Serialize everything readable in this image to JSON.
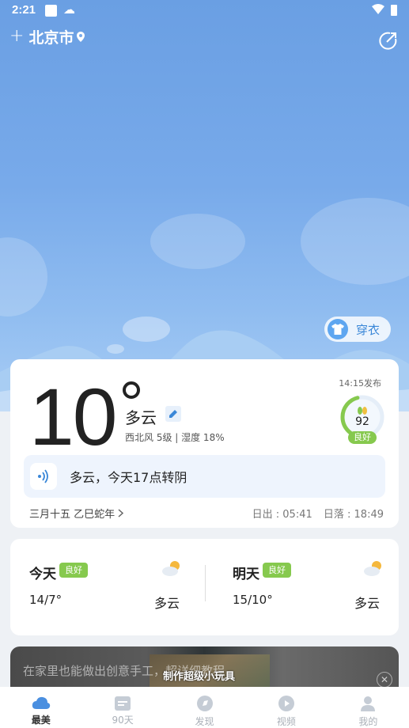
{
  "status_bar": {
    "time": "2:21"
  },
  "header": {
    "city": "北京市"
  },
  "clothing": {
    "label": "穿衣"
  },
  "current": {
    "temperature": "10",
    "condition": "多云",
    "wind_humidity": "西北风 5级 | 湿度 18%",
    "publish_time": "14:15发布",
    "aqi_value": "92",
    "aqi_label": "良好",
    "aqi_fraction": 0.46,
    "forecast_summary": "多云，今天17点转阴",
    "lunar_date": "三月十五 乙巳蛇年",
    "sunrise": "日出 : 05:41",
    "sunset": "日落 : 18:49"
  },
  "daily": [
    {
      "day": "今天",
      "badge": "良好",
      "temp": "14/7°",
      "condition": "多云",
      "icon": "partly-cloudy-icon"
    },
    {
      "day": "明天",
      "badge": "良好",
      "temp": "15/10°",
      "condition": "多云",
      "icon": "partly-cloudy-icon"
    }
  ],
  "ad": {
    "text": "在家里也能做出创意手工，超详细教程",
    "overlay": "制作超级小玩具",
    "close": "✕"
  },
  "nav": {
    "items": [
      {
        "label": "最美",
        "icon": "cloud-icon",
        "active": true
      },
      {
        "label": "90天",
        "icon": "calendar-icon",
        "active": false
      },
      {
        "label": "发现",
        "icon": "compass-icon",
        "active": false
      },
      {
        "label": "视频",
        "icon": "play-icon",
        "active": false
      },
      {
        "label": "我的",
        "icon": "user-icon",
        "active": false
      }
    ]
  },
  "colors": {
    "sky_top": "#6a9fe3",
    "accent_blue": "#3a87d8",
    "aqi_green": "#86c94e",
    "nav_active": "#4a8fe0",
    "nav_inactive": "#c5ccd5"
  }
}
